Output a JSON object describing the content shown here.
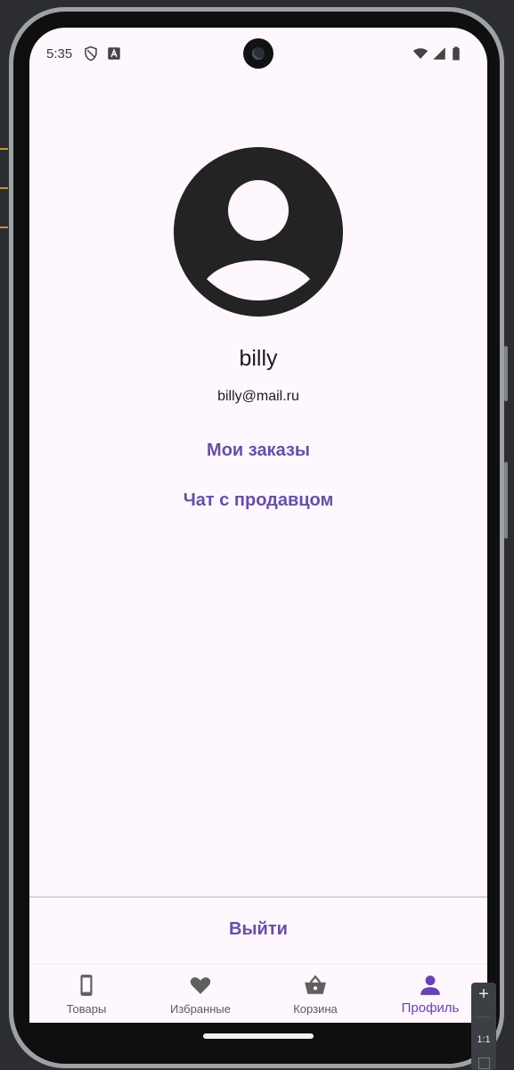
{
  "status_bar": {
    "time": "5:35",
    "icons": [
      "shield-icon",
      "text-a-icon",
      "wifi-icon",
      "signal-icon",
      "battery-icon"
    ]
  },
  "profile": {
    "avatar_icon": "account-circle-icon",
    "username": "billy",
    "email": "billy@mail.ru",
    "my_orders_label": "Мои заказы",
    "chat_with_seller_label": "Чат с продавцом"
  },
  "logout_label": "Выйти",
  "bottom_nav": {
    "items": [
      {
        "label": "Товары",
        "icon": "smartphone-icon",
        "active": false
      },
      {
        "label": "Избранные",
        "icon": "heart-icon",
        "active": false
      },
      {
        "label": "Корзина",
        "icon": "basket-icon",
        "active": false
      },
      {
        "label": "Профиль",
        "icon": "person-icon",
        "active": true
      }
    ]
  },
  "emulator_zoom": {
    "plus": "+",
    "ratio": "1:1"
  },
  "colors": {
    "screen_background": "#fff7fe",
    "accent": "#6750a4",
    "active_nav": "#6a42b0",
    "inactive_nav": "#5b5b5b",
    "text": "#1d1b20"
  }
}
